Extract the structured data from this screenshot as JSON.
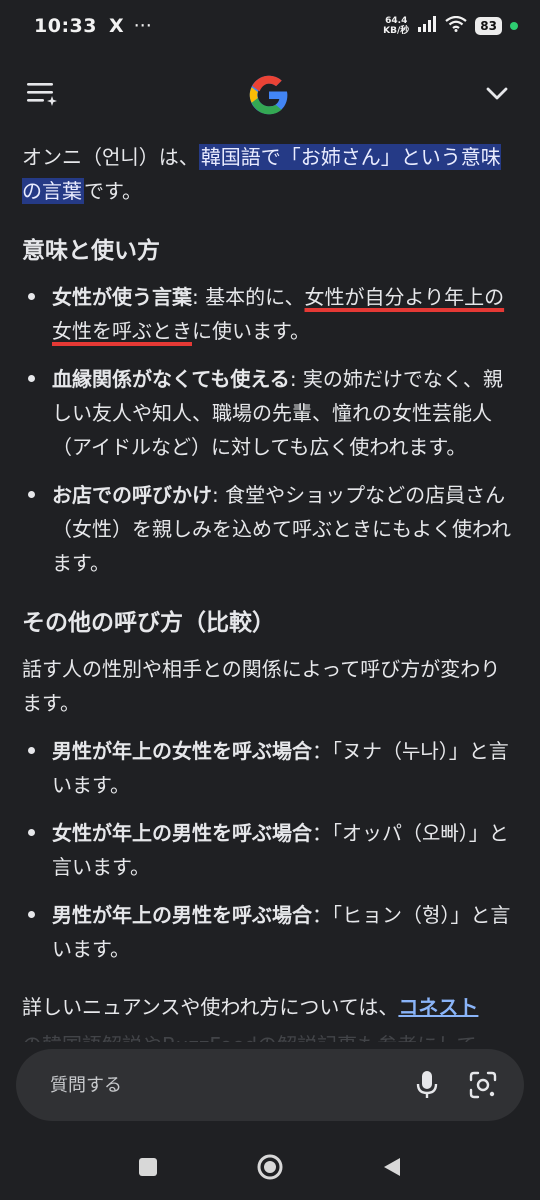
{
  "status_bar": {
    "time": "10:33",
    "x_icon": "X",
    "more": "···",
    "net_speed_value": "64.4",
    "net_speed_unit": "KB/秒",
    "battery": "83"
  },
  "header": {
    "menu_icon": "menu-sparkle-icon",
    "logo": "google-g-logo",
    "chevron_icon": "chevron-down-icon"
  },
  "colors": {
    "background": "#1f2023",
    "highlight": "#253a86",
    "underline": "#e53935",
    "link": "#8ab4f8"
  },
  "intro": {
    "prefix": "オンニ（언니）は、",
    "highlight": "韓国語で「お姉さん」という意味の言葉",
    "suffix": "です。"
  },
  "section1": {
    "title": "意味と使い方",
    "items": [
      {
        "term": "女性が使う言葉",
        "before": ": 基本的に、",
        "underlined": "女性が自分より年上の女性を呼ぶとき",
        "after": "に使います。"
      },
      {
        "term": "血縁関係がなくても使える",
        "text": ": 実の姉だけでなく、親しい友人や知人、職場の先輩、憧れの女性芸能人（アイドルなど）に対しても広く使われます。"
      },
      {
        "term": "お店での呼びかけ",
        "text": ": 食堂やショップなどの店員さん（女性）を親しみを込めて呼ぶときにもよく使われます。"
      }
    ]
  },
  "section2": {
    "title": "その他の呼び方（比較）",
    "intro": "話す人の性別や相手との関係によって呼び方が変わります。",
    "items": [
      {
        "term": "男性が年上の女性を呼ぶ場合",
        "text": "：「ヌナ（누나）」と言います。"
      },
      {
        "term": "女性が年上の男性を呼ぶ場合",
        "text": "：「オッパ（오빠）」と言います。"
      },
      {
        "term": "男性が年上の男性を呼ぶ場合",
        "text": "：「ヒョン（형）」と言います。"
      }
    ]
  },
  "footer_text": {
    "prefix": "詳しいニュアンスや使われ方については、",
    "link": "コネスト",
    "faded": "の韓国語解説やBuzzFeedの解説記事も参考にして"
  },
  "ask_bar": {
    "placeholder": "質問する",
    "mic_icon": "microphone-icon",
    "lens_icon": "google-lens-icon"
  },
  "nav_bar": {
    "recent_icon": "square-recents-icon",
    "home_icon": "circle-home-icon",
    "back_icon": "triangle-back-icon"
  }
}
